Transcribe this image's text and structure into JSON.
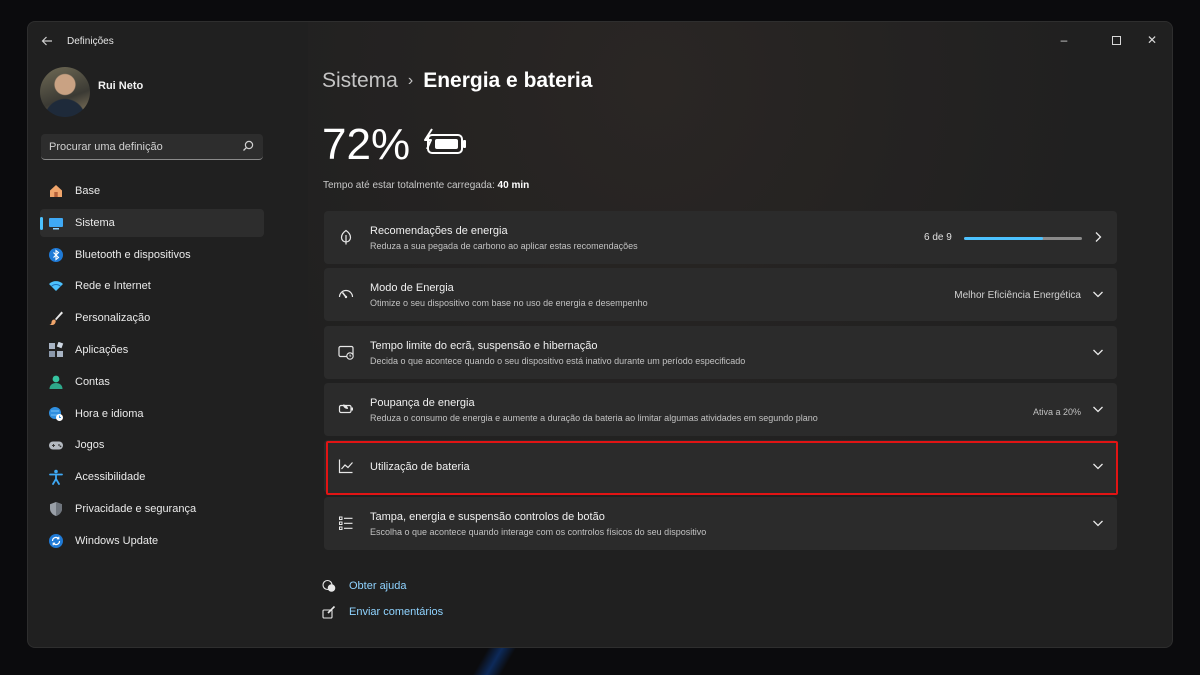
{
  "window": {
    "app_title": "Definições",
    "controls": {
      "minimize": "–",
      "close": "✕"
    }
  },
  "profile": {
    "name": "Rui Neto"
  },
  "search": {
    "placeholder": "Procurar uma definição"
  },
  "sidebar": {
    "items": [
      {
        "label": "Base",
        "icon": "home-icon"
      },
      {
        "label": "Sistema",
        "icon": "system-icon",
        "active": true
      },
      {
        "label": "Bluetooth e dispositivos",
        "icon": "bluetooth-icon"
      },
      {
        "label": "Rede e Internet",
        "icon": "wifi-icon"
      },
      {
        "label": "Personalização",
        "icon": "brush-icon"
      },
      {
        "label": "Aplicações",
        "icon": "apps-icon"
      },
      {
        "label": "Contas",
        "icon": "person-icon"
      },
      {
        "label": "Hora e idioma",
        "icon": "globe-clock-icon"
      },
      {
        "label": "Jogos",
        "icon": "gamepad-icon"
      },
      {
        "label": "Acessibilidade",
        "icon": "accessibility-icon"
      },
      {
        "label": "Privacidade e segurança",
        "icon": "shield-icon"
      },
      {
        "label": "Windows Update",
        "icon": "update-icon"
      }
    ]
  },
  "header": {
    "breadcrumb_parent": "Sistema",
    "breadcrumb_separator": "›",
    "breadcrumb_current": "Energia e bateria"
  },
  "battery": {
    "percent_text": "72%",
    "charge_label": "Tempo até estar totalmente carregada:",
    "charge_time": "40 min"
  },
  "cards": {
    "recommendations": {
      "title": "Recomendações de energia",
      "subtitle": "Reduza a sua pegada de carbono ao aplicar estas recomendações",
      "count": "6 de 9",
      "progress_fraction": 0.6667
    },
    "power_mode": {
      "title": "Modo de Energia",
      "subtitle": "Otimize o seu dispositivo com base no uso de energia e desempenho",
      "value": "Melhor Eficiência Energética"
    },
    "screen_sleep": {
      "title": "Tempo limite do ecrã, suspensão e hibernação",
      "subtitle": "Decida o que acontece quando o seu dispositivo está inativo durante um período especificado"
    },
    "energy_saver": {
      "title": "Poupança de energia",
      "subtitle": "Reduza o consumo de energia e aumente a duração da bateria ao limitar algumas atividades em segundo plano",
      "value": "Ativa a 20%"
    },
    "battery_usage": {
      "title": "Utilização de bateria"
    },
    "lid_buttons": {
      "title": "Tampa, energia e suspensão controlos de botão",
      "subtitle": "Escolha o que acontece quando interage com os controlos físicos do seu dispositivo"
    }
  },
  "links": {
    "help": "Obter ajuda",
    "feedback": "Enviar comentários"
  },
  "colors": {
    "accent": "#4cc2ff",
    "highlight_border": "#e11414",
    "card_background": "#2b2b2b",
    "window_background": "#202020"
  }
}
